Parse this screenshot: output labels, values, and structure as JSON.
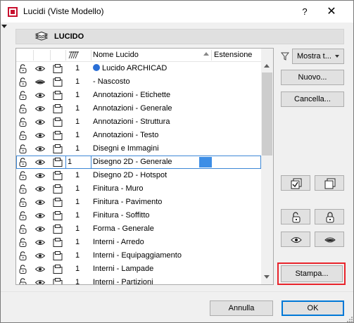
{
  "window": {
    "title": "Lucidi (Viste Modello)",
    "help_label": "?",
    "close_label": "✕"
  },
  "section": {
    "title": "LUCIDO"
  },
  "list": {
    "columns": {
      "name": "Nome Lucido",
      "extension": "Estensione"
    },
    "rows": [
      {
        "num": "1",
        "name": "Lucido ARCHICAD",
        "hidden": false,
        "archicad": true
      },
      {
        "num": "1",
        "name": "- Nascosto",
        "hidden": true
      },
      {
        "num": "1",
        "name": "Annotazioni - Etichette",
        "hidden": false
      },
      {
        "num": "1",
        "name": "Annotazioni - Generale",
        "hidden": false
      },
      {
        "num": "1",
        "name": "Annotazioni - Struttura",
        "hidden": false
      },
      {
        "num": "1",
        "name": "Annotazioni - Testo",
        "hidden": false
      },
      {
        "num": "1",
        "name": "Disegni e Immagini",
        "hidden": false
      },
      {
        "num": "1",
        "name": "Disegno 2D - Generale",
        "hidden": false,
        "selected": true
      },
      {
        "num": "1",
        "name": "Disegno 2D - Hotspot",
        "hidden": false
      },
      {
        "num": "1",
        "name": "Finitura - Muro",
        "hidden": false
      },
      {
        "num": "1",
        "name": "Finitura - Pavimento",
        "hidden": false
      },
      {
        "num": "1",
        "name": "Finitura - Soffitto",
        "hidden": false
      },
      {
        "num": "1",
        "name": "Forma - Generale",
        "hidden": false
      },
      {
        "num": "1",
        "name": "Interni - Arredo",
        "hidden": false
      },
      {
        "num": "1",
        "name": "Interni - Equipaggiamento",
        "hidden": false
      },
      {
        "num": "1",
        "name": "Interni - Lampade",
        "hidden": false
      },
      {
        "num": "1",
        "name": "Interni - Partizioni",
        "hidden": false
      }
    ]
  },
  "right_panel": {
    "filter_icon": "filter-icon",
    "show_dropdown": "Mostra t...",
    "new_label": "Nuovo...",
    "delete_label": "Cancella...",
    "print_label": "Stampa..."
  },
  "footer": {
    "cancel_label": "Annulla",
    "ok_label": "OK"
  },
  "colors": {
    "accent": "#0078d7",
    "highlight": "#e8242c",
    "selection": "#3d87d6"
  }
}
